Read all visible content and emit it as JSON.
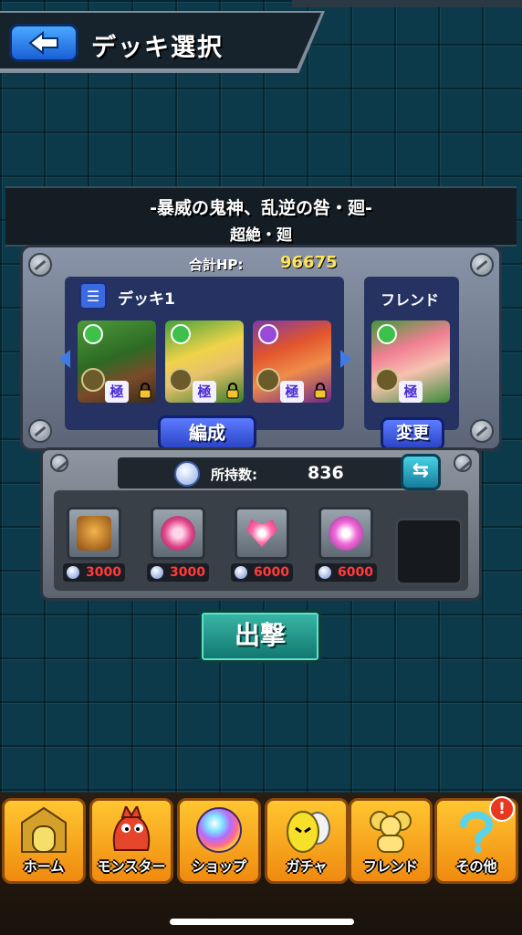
{
  "header": {
    "title": "デッキ選択"
  },
  "quest": {
    "name": "-暴威の鬼神、乱逆の咎・廻-",
    "difficulty": "超絶・廻"
  },
  "deck": {
    "hp_label": "合計HP:",
    "hp_value": "96675",
    "deck_name": "デッキ1",
    "friend_label": "フレンド",
    "edit_button": "編成",
    "change_button": "変更",
    "monsters": [
      {
        "element": "wood",
        "badge": "極"
      },
      {
        "element": "wood",
        "badge": "極"
      },
      {
        "element": "dark",
        "badge": "極"
      }
    ],
    "friend_monster": {
      "element": "wood",
      "badge": "極"
    }
  },
  "items": {
    "stone_label": "所持数:",
    "stone_count": "836",
    "list": [
      {
        "icon": "treasure-chest-icon",
        "cost": "3000"
      },
      {
        "icon": "speed-orb-icon",
        "cost": "3000"
      },
      {
        "icon": "heart-heal-icon",
        "cost": "6000"
      },
      {
        "icon": "sparkle-orb-icon",
        "cost": "6000"
      }
    ]
  },
  "sortie_button": "出撃",
  "nav": {
    "items": [
      {
        "label": "ホーム",
        "icon": "home-gate-icon"
      },
      {
        "label": "モンスター",
        "icon": "monster-icon"
      },
      {
        "label": "ショップ",
        "icon": "rainbow-orb-icon"
      },
      {
        "label": "ガチャ",
        "icon": "gacha-egg-icon"
      },
      {
        "label": "フレンド",
        "icon": "friends-icon"
      },
      {
        "label": "その他",
        "icon": "question-icon"
      }
    ],
    "notice": "!"
  },
  "colors": {
    "accent_blue": "#3b6ae0",
    "hp_yellow": "#ffe45a",
    "cost_red": "#ff3b3b",
    "nav_orange": "#f5a21c",
    "sortie_teal": "#2aa08f"
  }
}
